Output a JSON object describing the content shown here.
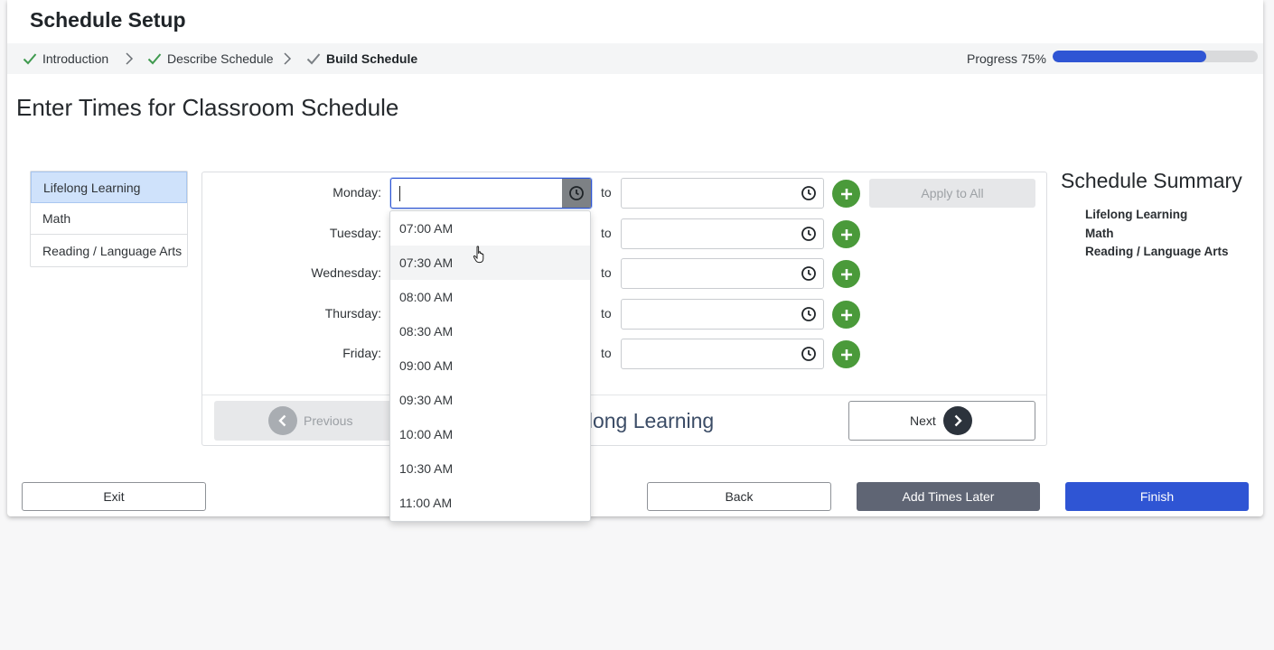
{
  "dialog": {
    "title": "Schedule Setup"
  },
  "steps": [
    {
      "label": "Introduction",
      "done": true
    },
    {
      "label": "Describe Schedule",
      "done": true
    },
    {
      "label": "Build Schedule",
      "done": false,
      "active": true
    }
  ],
  "progress": {
    "label": "Progress 75%",
    "value": 0.75,
    "color": "#2f55d4"
  },
  "page": {
    "heading": "Enter Times for Classroom Schedule"
  },
  "categories": [
    {
      "label": "Lifelong Learning",
      "selected": true
    },
    {
      "label": "Math",
      "selected": false
    },
    {
      "label": "Reading / Language Arts",
      "selected": false
    }
  ],
  "days": [
    {
      "label": "Monday:",
      "start": "",
      "end": ""
    },
    {
      "label": "Tuesday:",
      "start": "",
      "end": ""
    },
    {
      "label": "Wednesday:",
      "start": "",
      "end": ""
    },
    {
      "label": "Thursday:",
      "start": "",
      "end": ""
    },
    {
      "label": "Friday:",
      "start": "",
      "end": ""
    }
  ],
  "to_label": "to",
  "apply_to_all": "Apply to All",
  "panel_footer": {
    "previous": "Previous",
    "current_category": "Lifelong Learning",
    "next": "Next"
  },
  "summary": {
    "title": "Schedule Summary",
    "items": [
      "Lifelong Learning",
      "Math",
      "Reading / Language Arts"
    ]
  },
  "dropdown": {
    "options": [
      "07:00 AM",
      "07:30 AM",
      "08:00 AM",
      "08:30 AM",
      "09:00 AM",
      "09:30 AM",
      "10:00 AM",
      "10:30 AM",
      "11:00 AM"
    ],
    "hovered": "07:30 AM"
  },
  "buttons": {
    "exit": "Exit",
    "back": "Back",
    "add_later": "Add Times Later",
    "finish": "Finish"
  },
  "colors": {
    "accent": "#2f55d4",
    "add_green": "#4a9a3a",
    "secondary": "#5f6574",
    "selected_bg": "#cfe2fb"
  }
}
